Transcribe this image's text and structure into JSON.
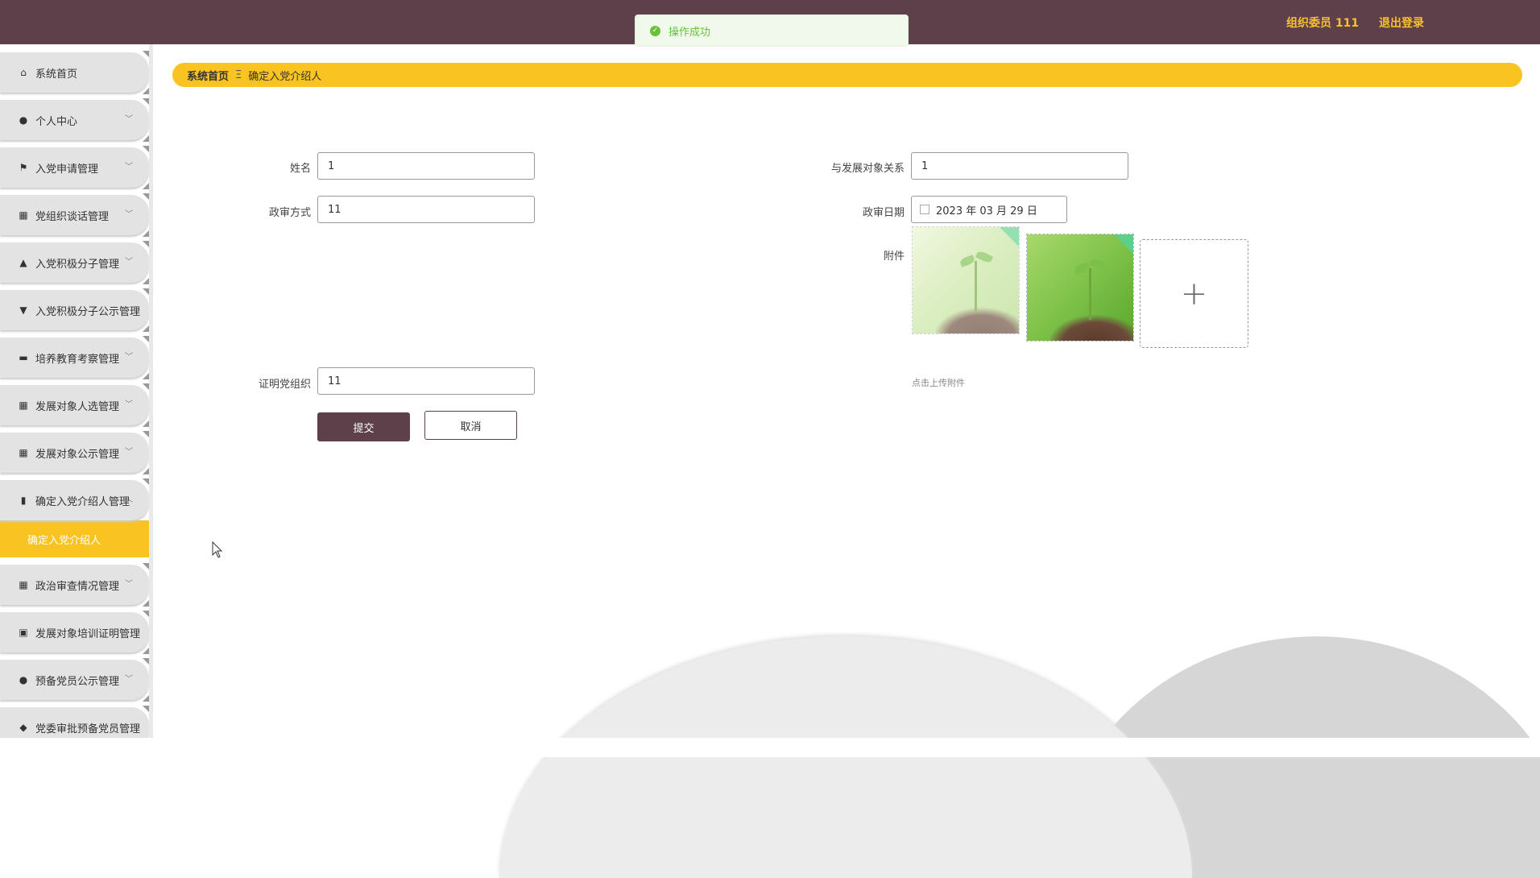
{
  "header": {
    "user": "组织委员 111",
    "logout": "退出登录"
  },
  "toast": {
    "message": "操作成功"
  },
  "sidebar": {
    "items": [
      {
        "label": "系统首页",
        "icon": "home-icon"
      },
      {
        "label": "个人中心",
        "icon": "user-icon"
      },
      {
        "label": "入党申请管理",
        "icon": "flag-icon"
      },
      {
        "label": "党组织谈话管理",
        "icon": "grid-icon"
      },
      {
        "label": "入党积极分子管理",
        "icon": "chart-line-icon"
      },
      {
        "label": "入党积极分子公示管理",
        "icon": "brush-icon"
      },
      {
        "label": "培养教育考察管理",
        "icon": "briefcase-icon"
      },
      {
        "label": "发展对象人选管理",
        "icon": "grid-icon"
      },
      {
        "label": "发展对象公示管理",
        "icon": "grid-icon"
      },
      {
        "label": "确定入党介绍人管理",
        "icon": "bar-chart-icon"
      },
      {
        "label": "政治审查情况管理",
        "icon": "grid-icon"
      },
      {
        "label": "发展对象培训证明管理",
        "icon": "trash-icon"
      },
      {
        "label": "预备党员公示管理",
        "icon": "user-icon"
      },
      {
        "label": "党委审批预备党员管理",
        "icon": "location-icon"
      }
    ],
    "active_sub": "确定入党介绍人"
  },
  "breadcrumb": {
    "home": "系统首页",
    "separator": "Ξ",
    "current": "确定入党介绍人"
  },
  "form": {
    "name_label": "姓名",
    "name_value": "1",
    "relation_label": "与发展对象关系",
    "relation_value": "1",
    "review_method_label": "政审方式",
    "review_method_value": "11",
    "review_date_label": "政审日期",
    "review_date_value": "2023 年 03 月 29 日",
    "attachment_label": "附件",
    "attachment_hint": "点击上传附件",
    "proof_org_label": "证明党组织",
    "proof_org_value": "11",
    "submit": "提交",
    "cancel": "取消"
  },
  "colors": {
    "header": "#5d4049",
    "accent": "#f9c322",
    "success": "#67c23a"
  }
}
